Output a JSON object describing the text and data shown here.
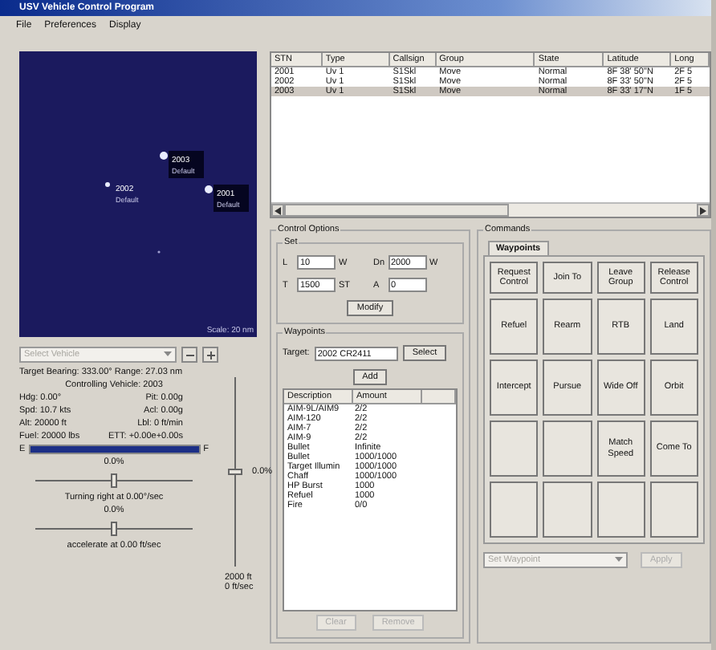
{
  "window": {
    "title": "USV Vehicle Control Program"
  },
  "menu": [
    "File",
    "Preferences",
    "Display"
  ],
  "map": {
    "scale": "Scale: 20 nm",
    "vehicles": [
      {
        "id": "2002",
        "label": "Default",
        "selected": false
      },
      {
        "id": "2003",
        "label": "Default",
        "selected": true
      },
      {
        "id": "2001",
        "label": "Default",
        "selected": true
      }
    ]
  },
  "vehicle_select": {
    "placeholder": "Select Vehicle"
  },
  "target_info": "Target Bearing: 333.00° Range: 27.03 nm",
  "controlling": "Controlling Vehicle: 2003",
  "readouts": [
    [
      "Hdg: 0.00°",
      "Pit: 0.00g"
    ],
    [
      "Spd: 10.7 kts",
      "Acl: 0.00g"
    ],
    [
      "Alt: 20000 ft",
      "Lbl: 0 ft/min"
    ],
    [
      "Fuel: 20000 lbs",
      "ETT: +0.00e+0.00s"
    ]
  ],
  "fuel": {
    "empty": "E",
    "full": "F",
    "level": 1
  },
  "turn": {
    "reading": "0.0%",
    "level": 0.5,
    "caption": "Turning right at 0.00°/sec"
  },
  "accel": {
    "reading": "0.0%",
    "level": 0.5,
    "caption": "accelerate at 0.00 ft/sec"
  },
  "altitude": {
    "reading": "0.0%",
    "level": 0.5,
    "value": "2000 ft",
    "rate": "0 ft/sec"
  },
  "vehicles_table": {
    "columns": [
      "STN",
      "Type",
      "Callsign",
      "Group",
      "State",
      "Latitude",
      "Long"
    ],
    "rows": [
      {
        "cells": [
          "2001",
          "Uv 1",
          "S1Skl",
          "Move",
          "Normal",
          "8F 38' 50\"N",
          "2F 5"
        ],
        "selected": false
      },
      {
        "cells": [
          "2002",
          "Uv 1",
          "S1Skl",
          "Move",
          "Normal",
          "8F 33' 50\"N",
          "2F 5"
        ],
        "selected": false
      },
      {
        "cells": [
          "2003",
          "Uv 1",
          "S1Skl",
          "Move",
          "Normal",
          "8F 33' 17\"N",
          "1F 5"
        ],
        "selected": true
      }
    ]
  },
  "control_options": {
    "title": "Control Options",
    "set": {
      "title": "Set",
      "fields": [
        {
          "label": "L",
          "value": "10",
          "unit": "W"
        },
        {
          "label": "Dn",
          "value": "2000",
          "unit": "W"
        },
        {
          "label": "T",
          "value": "1500",
          "unit": "ST"
        },
        {
          "label": "A",
          "value": "0"
        }
      ],
      "button": "Modify"
    },
    "waypoints": {
      "title": "Waypoints",
      "target_label": "Target:",
      "target": "2002 CR2411",
      "select": "Select",
      "add": "Add",
      "columns": [
        "Description",
        "Amount"
      ],
      "rows": [
        [
          "AIM-9L/AIM9",
          "2/2"
        ],
        [
          "AIM-120",
          "2/2"
        ],
        [
          "AIM-7",
          "2/2"
        ],
        [
          "AIM-9",
          "2/2"
        ],
        [
          "Bullet",
          "Infinite"
        ],
        [
          "Bullet",
          "1000/1000"
        ],
        [
          "Target Illumin",
          "1000/1000"
        ],
        [
          "Chaff",
          "1000/1000"
        ],
        [
          "HP Burst",
          "1000"
        ],
        [
          "Refuel",
          "1000"
        ],
        [
          "Fire",
          "0/0"
        ]
      ],
      "buttons": [
        {
          "label": "Clear",
          "disabled": true
        },
        {
          "label": "Remove",
          "disabled": true
        }
      ]
    }
  },
  "commands": {
    "title": "Commands",
    "tab": {
      "label": "Waypoints",
      "selected": true
    },
    "buttons": [
      {
        "kind": "command",
        "label": "Request Control"
      },
      {
        "kind": "command",
        "label": "Join To"
      },
      {
        "kind": "command",
        "label": "Leave Group"
      },
      {
        "kind": "command",
        "label": "Release Control"
      },
      {
        "kind": "command",
        "label": "Refuel"
      },
      {
        "kind": "command",
        "label": "Rearm"
      },
      {
        "kind": "command",
        "label": "RTB"
      },
      {
        "kind": "command",
        "label": "Land"
      },
      {
        "kind": "command",
        "label": "Intercept"
      },
      {
        "kind": "command",
        "label": "Pursue"
      },
      {
        "kind": "command",
        "label": "Wide Off"
      },
      {
        "kind": "command",
        "label": "Orbit"
      },
      {
        "kind": "blank"
      },
      {
        "kind": "blank"
      },
      {
        "kind": "command",
        "label": "Match Speed"
      },
      {
        "kind": "command",
        "label": "Come To"
      },
      {
        "kind": "blank"
      },
      {
        "kind": "blank"
      },
      {
        "kind": "blank"
      },
      {
        "kind": "blank"
      }
    ],
    "waypoint_select": {
      "placeholder": "Set Waypoint",
      "disabled": true
    },
    "apply": {
      "label": "Apply",
      "disabled": true
    }
  }
}
